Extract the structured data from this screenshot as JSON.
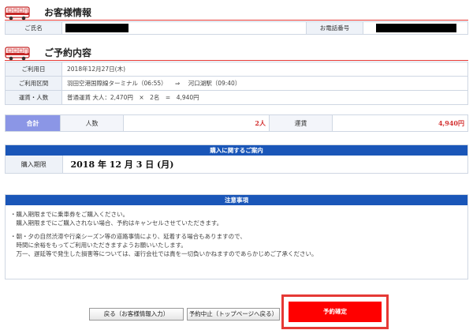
{
  "customer": {
    "title": "お客様情報",
    "name_label": "ご氏名",
    "phone_label": "お電話番号"
  },
  "reservation": {
    "title": "ご予約内容",
    "date_label": "ご利用日",
    "date_value": "2018年12月27日(木)",
    "route_label": "ご利用区間",
    "route_from": "羽田空港国際線ターミナル（06:55）",
    "route_arrow": "⇒",
    "route_to": "河口湖駅（09:40）",
    "fare_label": "運賃・人数",
    "fare_value": "普通運賃 大人：2,470円　×　2名　=　4,940円"
  },
  "totals": {
    "label": "合計",
    "people_label": "人数",
    "people_value": "2人",
    "fare_label": "運賃",
    "fare_value": "4,940円"
  },
  "purchase": {
    "header": "購入に関するご案内",
    "deadline_label": "購入期限",
    "deadline_value": "2018 年 12 月 3 日 (月)"
  },
  "notes": {
    "header": "注意事項",
    "lines": [
      "・購入期限までに乗車券をご購入ください。",
      "　購入期限までにご購入されない場合、予約はキャンセルさせていただきます。",
      "・朝・夕の自然渋滞や行楽シーズン等の道路事情により、延着する場合もありますので、",
      "　時間に余裕をもってご利用いただきますようお願いいたします。",
      "　万一、遅延等で発生した損害等については、運行会社では責を一切負いかねますのであらかじめご了承ください。"
    ]
  },
  "buttons": {
    "back": "戻る（お客様情報入力）",
    "cancel": "予約中止（トップページへ戻る）",
    "confirm": "予約確定"
  },
  "colors": {
    "accent_red": "#e53935",
    "header_blue": "#1a56b8",
    "total_purple": "#8b96e6"
  }
}
